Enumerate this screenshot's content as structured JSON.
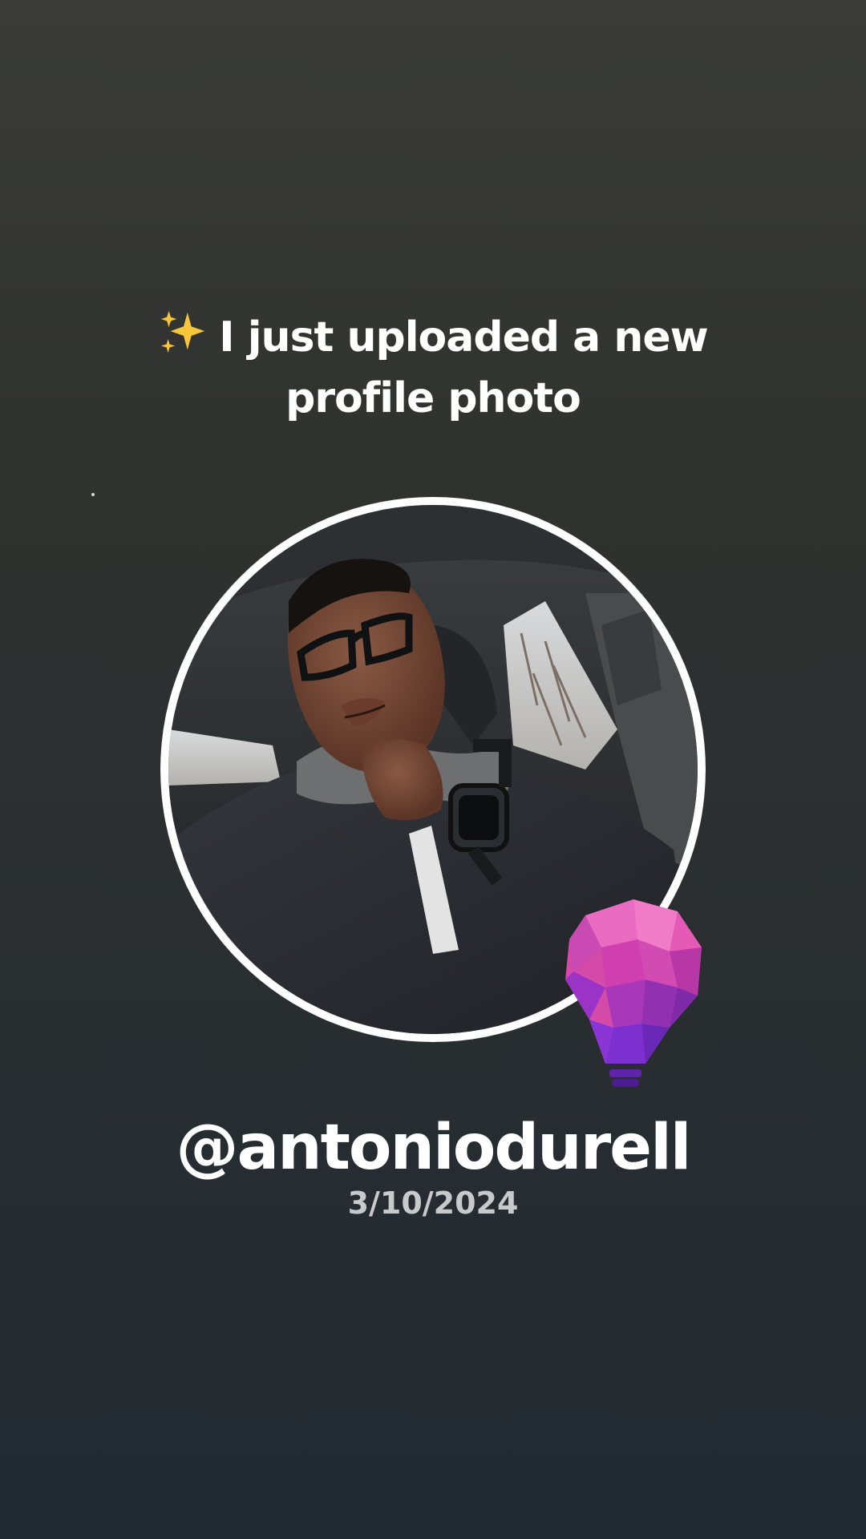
{
  "headline": {
    "icon": "sparkles-icon",
    "line1": "I just uploaded a new",
    "line2": "profile photo"
  },
  "profile": {
    "photo": "profile-photo",
    "badge_icon": "lightbulb-icon",
    "username": "@antoniodurell",
    "date": "3/10/2024"
  },
  "colors": {
    "background_top": "#3a3b39",
    "background_bottom": "#212a31",
    "text": "#ffffff",
    "date_text": "#c7c9cb",
    "ring": "#ffffff",
    "badge_pink": "#e85ab6",
    "badge_purple": "#7a2fd6"
  }
}
